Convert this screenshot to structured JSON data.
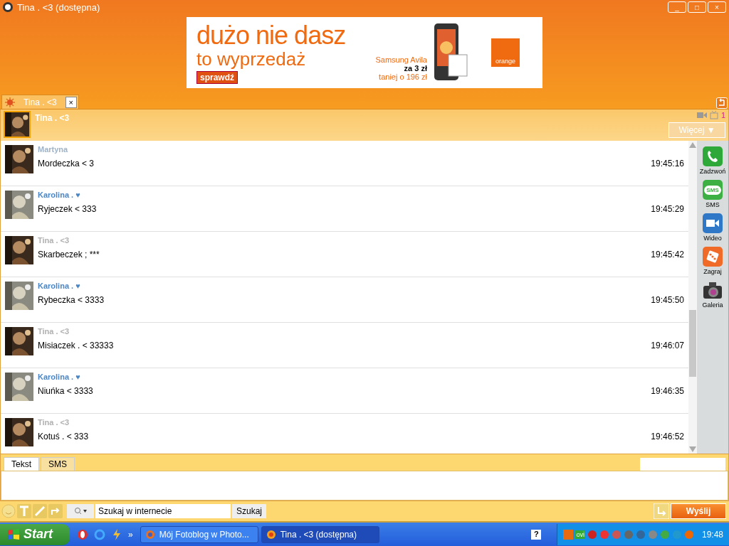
{
  "window": {
    "title": "Tina . <3 (dostępna)",
    "controls": [
      "_",
      "□",
      "×"
    ]
  },
  "ad": {
    "headline": "dużo nie dasz",
    "subline": "to wyprzedaż",
    "button": "sprawdź",
    "product": "Samsung Avila",
    "price": "za 3 zł",
    "discount": "taniej o 196 zł",
    "brand": "orange"
  },
  "tabs": [
    {
      "label": "Tina . <3",
      "selected": true,
      "close": "×"
    }
  ],
  "header": {
    "name": "Tina . <3",
    "count": "1",
    "more_button": "Więcej ▼"
  },
  "messages": [
    {
      "sender": "Martyna",
      "color": "#9fb3c8",
      "text": "Mordeczka < 3",
      "time": "19:45:16"
    },
    {
      "sender": "Karolina . ♥",
      "color": "#4a86c5",
      "text": "Ryjeczek < 333",
      "time": "19:45:29"
    },
    {
      "sender": "Tina . <3",
      "color": "#b0b0b0",
      "text": "Skarbeczek ; ***",
      "time": "19:45:42"
    },
    {
      "sender": "Karolina . ♥",
      "color": "#4a86c5",
      "text": "Rybeczka < 3333",
      "time": "19:45:50"
    },
    {
      "sender": "Tina . <3",
      "color": "#b0b0b0",
      "text": "Misiaczek . < 33333",
      "time": "19:46:07"
    },
    {
      "sender": "Karolina . ♥",
      "color": "#4a86c5",
      "text": "Niuńka < 3333",
      "time": "19:46:35"
    },
    {
      "sender": "Tina . <3",
      "color": "#b0b0b0",
      "text": "Kotuś . < 333",
      "time": "19:46:52"
    }
  ],
  "actions": [
    {
      "kind": "call",
      "label": "Zadzwoń"
    },
    {
      "kind": "sms",
      "label": "SMS",
      "icon_text": "SMS"
    },
    {
      "kind": "video",
      "label": "Wideo"
    },
    {
      "kind": "game",
      "label": "Zagraj"
    },
    {
      "kind": "gallery",
      "label": "Galeria"
    }
  ],
  "input_tabs": [
    {
      "label": "Tekst",
      "selected": true
    },
    {
      "label": "SMS",
      "selected": false
    }
  ],
  "toolbar": {
    "search_placeholder": "Szukaj w internecie",
    "search_button": "Szukaj",
    "send_button": "Wyślij"
  },
  "taskbar": {
    "start": "Start",
    "tasks": [
      {
        "label": "Mój Fotoblog w Photo...",
        "selected": false
      },
      {
        "label": "Tina . <3 (dostępna)",
        "selected": true
      }
    ],
    "more": "»",
    "help": "?",
    "tray_label": "ovi",
    "clock": "19:48"
  }
}
